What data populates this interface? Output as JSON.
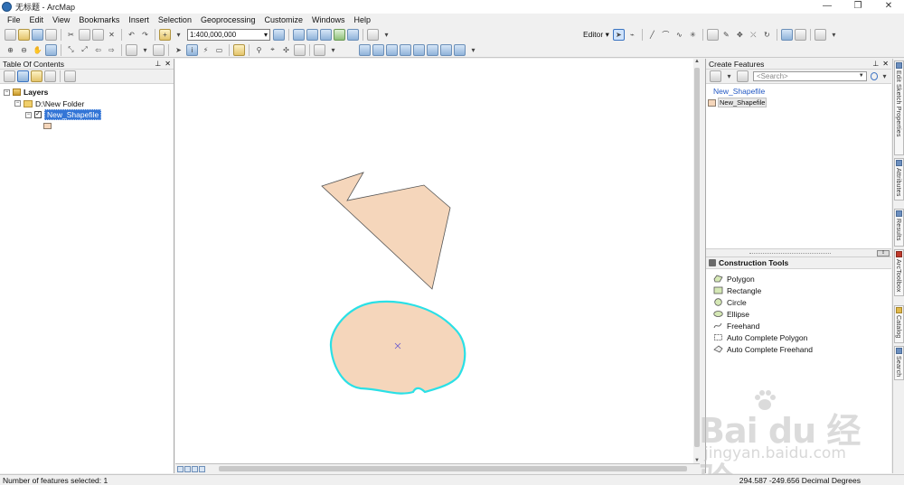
{
  "window": {
    "title": "无标题 - ArcMap",
    "controls": {
      "minimize": "—",
      "maximize": "❐",
      "close": "✕"
    }
  },
  "menu": [
    "File",
    "Edit",
    "View",
    "Bookmarks",
    "Insert",
    "Selection",
    "Geoprocessing",
    "Customize",
    "Windows",
    "Help"
  ],
  "toolbar": {
    "scale": "1:400,000,000",
    "editor_label": "Editor"
  },
  "toc": {
    "title": "Table Of Contents",
    "root_label": "Layers",
    "folder_label": "D:\\New Folder",
    "layer_label": "New_Shapefile",
    "layer_checked": true,
    "symbol_color": "#f5d6bb"
  },
  "map": {
    "polygon_fill": "#f5d6bb",
    "polygon_stroke": "#555555",
    "selection_color": "#2ae0e6"
  },
  "create_features": {
    "title": "Create Features",
    "search_placeholder": "<Search>",
    "template_group": "New_Shapefile",
    "template_item": "New_Shapefile"
  },
  "construction_tools": {
    "title": "Construction Tools",
    "items": [
      "Polygon",
      "Rectangle",
      "Circle",
      "Ellipse",
      "Freehand",
      "Auto Complete Polygon",
      "Auto Complete Freehand"
    ]
  },
  "dock_tabs": [
    "Edit Sketch Properties",
    "Attributes",
    "Results",
    "ArcToolbox",
    "Catalog",
    "Search"
  ],
  "status": {
    "left": "Number of features selected: 1",
    "coords": "294.587  -249.656 Decimal Degrees"
  },
  "watermark": {
    "logo": "Bai du 经验",
    "url": "jingyan.baidu.com"
  }
}
